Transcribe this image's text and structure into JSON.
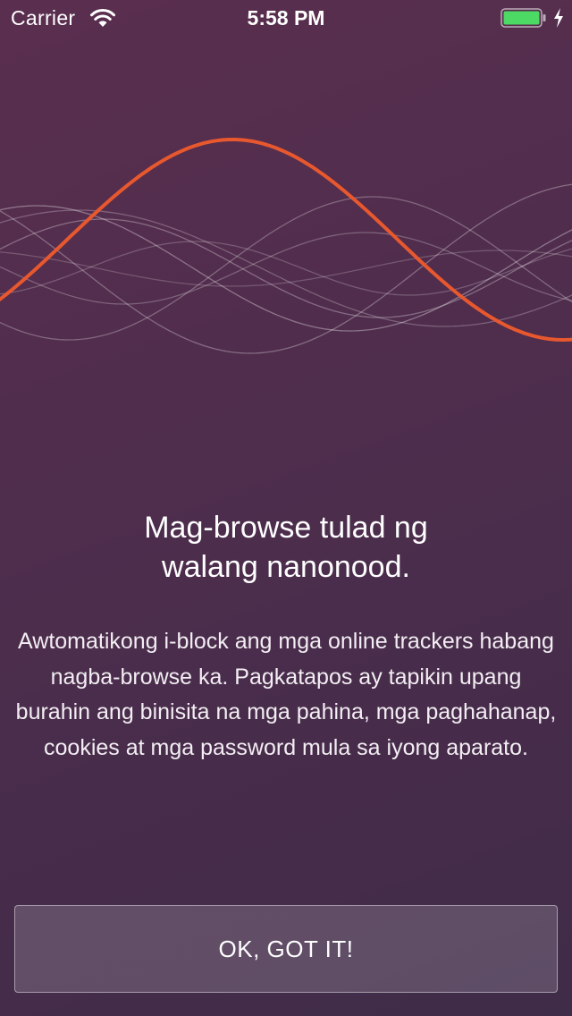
{
  "status_bar": {
    "carrier": "Carrier",
    "time": "5:58 PM",
    "battery_color": "#4cd964"
  },
  "hero": {
    "wave_accent_color": "#e8582e",
    "icons": [
      "wifi-icon",
      "battery-icon",
      "charging-bolt-icon"
    ]
  },
  "content": {
    "title_line1": "Mag-browse tulad ng",
    "title_line2": "walang nanonood.",
    "description": "Awtomatikong i-block ang mga online trackers habang nagba-browse ka. Pagkatapos ay tapikin upang burahin ang binisita na mga pahina, mga paghahanap, cookies at mga password mula sa iyong aparato."
  },
  "actions": {
    "ok_label": "OK, GOT IT!"
  }
}
